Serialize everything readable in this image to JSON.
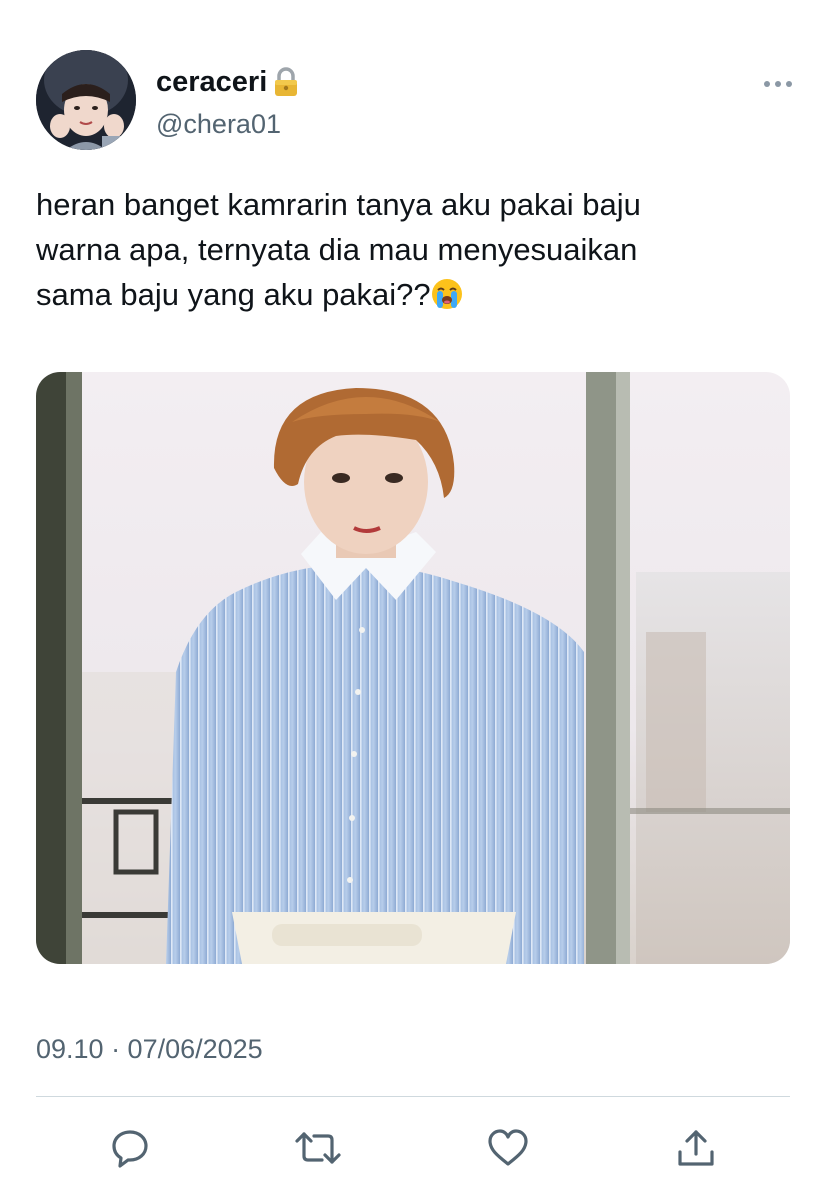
{
  "tweet": {
    "author": {
      "display_name": "ceraceri",
      "handle": "@chera01",
      "avatar_icon": "avatar",
      "protected_icon": "lock-icon"
    },
    "text_lines": [
      "heran banget kamrarin tanya aku pakai baju",
      "warna apa, ternyata dia mau menyesuaikan",
      "sama baju yang aku pakai??"
    ],
    "text_emoji_icon": "loudly-crying-face-icon",
    "media": {
      "image_icon": "photo-person-blue-striped-shirt"
    },
    "timestamp": "09.10 · 07/06/2025",
    "actions": {
      "reply_icon": "reply-icon",
      "retweet_icon": "retweet-icon",
      "like_icon": "heart-icon",
      "share_icon": "share-icon"
    },
    "more_icon": "more-icon"
  },
  "colors": {
    "text_primary": "#0f1419",
    "text_secondary": "#536471",
    "icon": "#536471",
    "divider": "#cfd9de"
  }
}
